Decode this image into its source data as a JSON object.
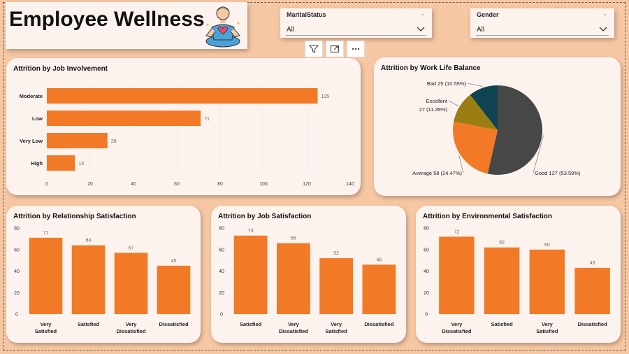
{
  "header": {
    "title": "Employee Wellness"
  },
  "slicers": [
    {
      "label": "MaritalStatus",
      "value": "All"
    },
    {
      "label": "Gender",
      "value": "All"
    }
  ],
  "toolbar": {
    "filter_icon": "filter-icon",
    "focus_icon": "focus-mode-icon",
    "more_icon": "more-options-icon"
  },
  "colors": {
    "bar": "#f27a26",
    "pie_good": "#474747",
    "pie_average": "#f27a26",
    "pie_excellent": "#9b7e12",
    "pie_bad": "#0f4351",
    "card_bg": "#fdf3ee",
    "page_bg": "#f6c7a3"
  },
  "chart_data": [
    {
      "type": "bar",
      "orientation": "horizontal",
      "title": "Attrition  by Job Involvement",
      "categories": [
        "Moderate",
        "Low",
        "Very Low",
        "High"
      ],
      "values": [
        125,
        71,
        28,
        13
      ],
      "xlim": [
        0,
        140
      ],
      "xticks": [
        "0",
        "20",
        "40",
        "60",
        "80",
        "100",
        "120",
        "140"
      ],
      "grid": true
    },
    {
      "type": "pie",
      "title": "Attrition by Work Life Balance",
      "slices": [
        {
          "label": "Good",
          "value": 127,
          "pct": "53.59%",
          "text": "Good 127 (53.59%)"
        },
        {
          "label": "Average",
          "value": 58,
          "pct": "24.47%",
          "text": "Average 58 (24.47%)"
        },
        {
          "label": "Excellent",
          "value": 27,
          "pct": "11.39%",
          "text": "Excellent"
        },
        {
          "label": "Bad",
          "value": 25,
          "pct": "10.55%",
          "text": "Bad 25 (10.55%)"
        }
      ],
      "excellent_detail": "27 (11.39%)"
    },
    {
      "type": "bar",
      "title": "Attrition  by Relationship Satisfaction",
      "categories": [
        "Very Satisfied",
        "Satisfied",
        "Very Dissatisfied",
        "Dissatisfied"
      ],
      "values": [
        71,
        64,
        57,
        45
      ],
      "ylim": [
        0,
        80
      ],
      "yticks": [
        "0",
        "20",
        "40",
        "60",
        "80"
      ]
    },
    {
      "type": "bar",
      "title": "Attrition  by Job Satisfaction",
      "categories": [
        "Satisfied",
        "Very Dissatisfied",
        "Very Satisfied",
        "Dissatisfied"
      ],
      "values": [
        73,
        66,
        52,
        46
      ],
      "ylim": [
        0,
        80
      ],
      "yticks": [
        "0",
        "20",
        "40",
        "60",
        "80"
      ]
    },
    {
      "type": "bar",
      "title": "Attrition  by Environmental Satisfaction",
      "categories": [
        "Very Dissatisfied",
        "Satisfied",
        "Very Satisfied",
        "Dissatisfied"
      ],
      "values": [
        72,
        62,
        60,
        43
      ],
      "ylim": [
        0,
        80
      ],
      "yticks": [
        "0",
        "20",
        "40",
        "60",
        "80"
      ]
    }
  ]
}
